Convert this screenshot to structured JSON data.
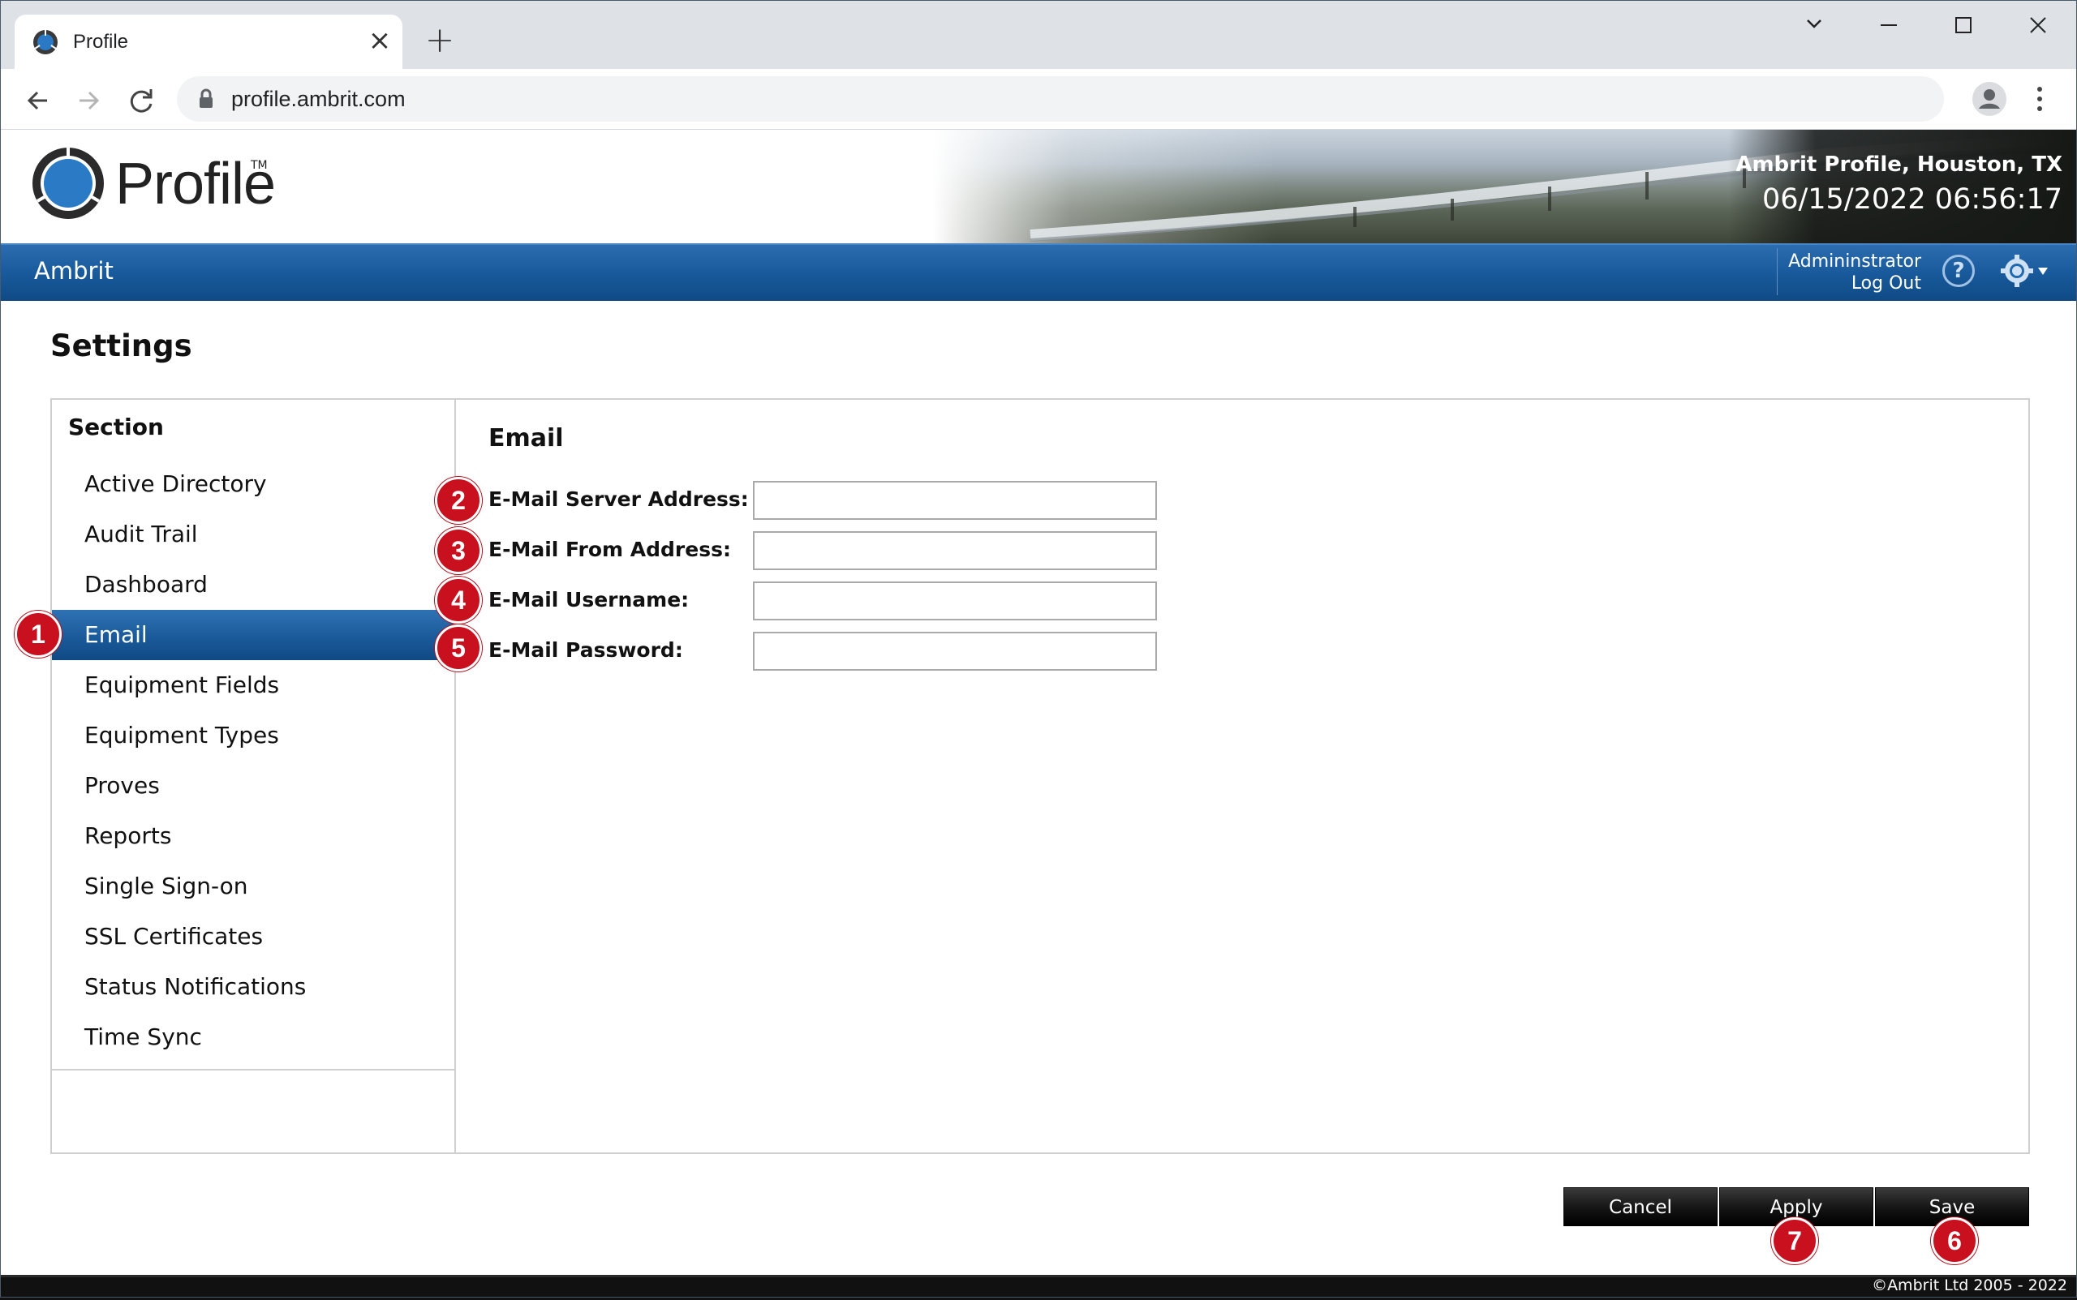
{
  "browser": {
    "tab_title": "Profile",
    "url": "profile.ambrit.com"
  },
  "header": {
    "logo_text": "Profile",
    "logo_tm": "TM",
    "site_name": "Ambrit Profile, Houston, TX",
    "datetime": "06/15/2022 06:56:17"
  },
  "navbar": {
    "organization": "Ambrit",
    "user_name": "Admininstrator",
    "logout_label": "Log Out",
    "help_label": "?"
  },
  "page": {
    "title": "Settings"
  },
  "sidebar": {
    "header": "Section",
    "items": [
      {
        "label": "Active Directory"
      },
      {
        "label": "Audit Trail"
      },
      {
        "label": "Dashboard"
      },
      {
        "label": "Email",
        "active": true
      },
      {
        "label": "Equipment Fields"
      },
      {
        "label": "Equipment Types"
      },
      {
        "label": "Proves"
      },
      {
        "label": "Reports"
      },
      {
        "label": "Single Sign-on"
      },
      {
        "label": "SSL Certificates"
      },
      {
        "label": "Status Notifications"
      },
      {
        "label": "Time Sync"
      }
    ]
  },
  "content": {
    "title": "Email",
    "fields": [
      {
        "label": "E-Mail Server Address:",
        "value": ""
      },
      {
        "label": "E-Mail From Address:",
        "value": ""
      },
      {
        "label": "E-Mail Username:",
        "value": ""
      },
      {
        "label": "E-Mail Password:",
        "value": ""
      }
    ]
  },
  "actions": {
    "cancel_label": "Cancel",
    "apply_label": "Apply",
    "save_label": "Save"
  },
  "markers": [
    "1",
    "2",
    "3",
    "4",
    "5",
    "6",
    "7"
  ],
  "footer": {
    "copyright": "©Ambrit Ltd 2005 - 2022"
  },
  "colors": {
    "nav_blue": "#195a9c",
    "marker_red": "#c8101e",
    "button_black": "#141414"
  }
}
